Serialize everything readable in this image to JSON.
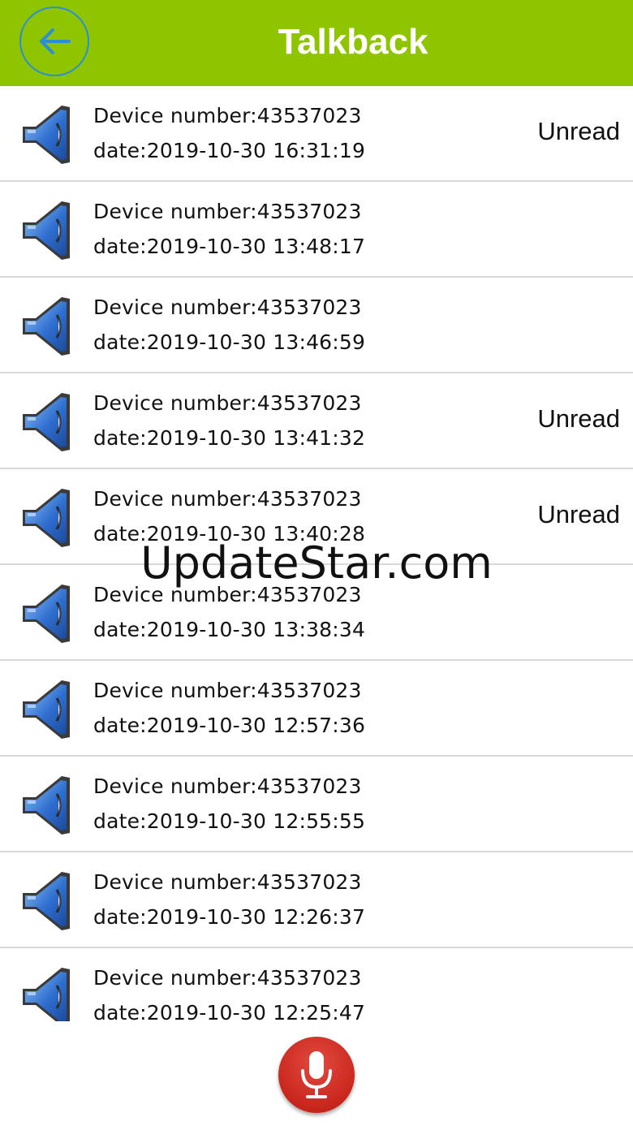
{
  "header": {
    "title": "Talkback"
  },
  "colors": {
    "header_bg": "#8fc400",
    "back_ring": "#2b8fd6",
    "mic_button": "#c9261d",
    "speaker_icon": "#2f6fd0"
  },
  "icons": {
    "back": "arrow-left-icon",
    "row": "speaker-icon",
    "record": "microphone-icon"
  },
  "messages": [
    {
      "device": "Device number:43537023",
      "date": "date:2019-10-30 16:31:19",
      "status": "Unread"
    },
    {
      "device": "Device number:43537023",
      "date": "date:2019-10-30 13:48:17",
      "status": ""
    },
    {
      "device": "Device number:43537023",
      "date": "date:2019-10-30 13:46:59",
      "status": ""
    },
    {
      "device": "Device number:43537023",
      "date": "date:2019-10-30 13:41:32",
      "status": "Unread"
    },
    {
      "device": "Device number:43537023",
      "date": "date:2019-10-30 13:40:28",
      "status": "Unread"
    },
    {
      "device": "Device number:43537023",
      "date": "date:2019-10-30 13:38:34",
      "status": ""
    },
    {
      "device": "Device number:43537023",
      "date": "date:2019-10-30 12:57:36",
      "status": ""
    },
    {
      "device": "Device number:43537023",
      "date": "date:2019-10-30 12:55:55",
      "status": ""
    },
    {
      "device": "Device number:43537023",
      "date": "date:2019-10-30 12:26:37",
      "status": ""
    },
    {
      "device": "Device number:43537023",
      "date": "date:2019-10-30 12:25:47",
      "status": ""
    }
  ],
  "watermark": "UpdateStar.com"
}
